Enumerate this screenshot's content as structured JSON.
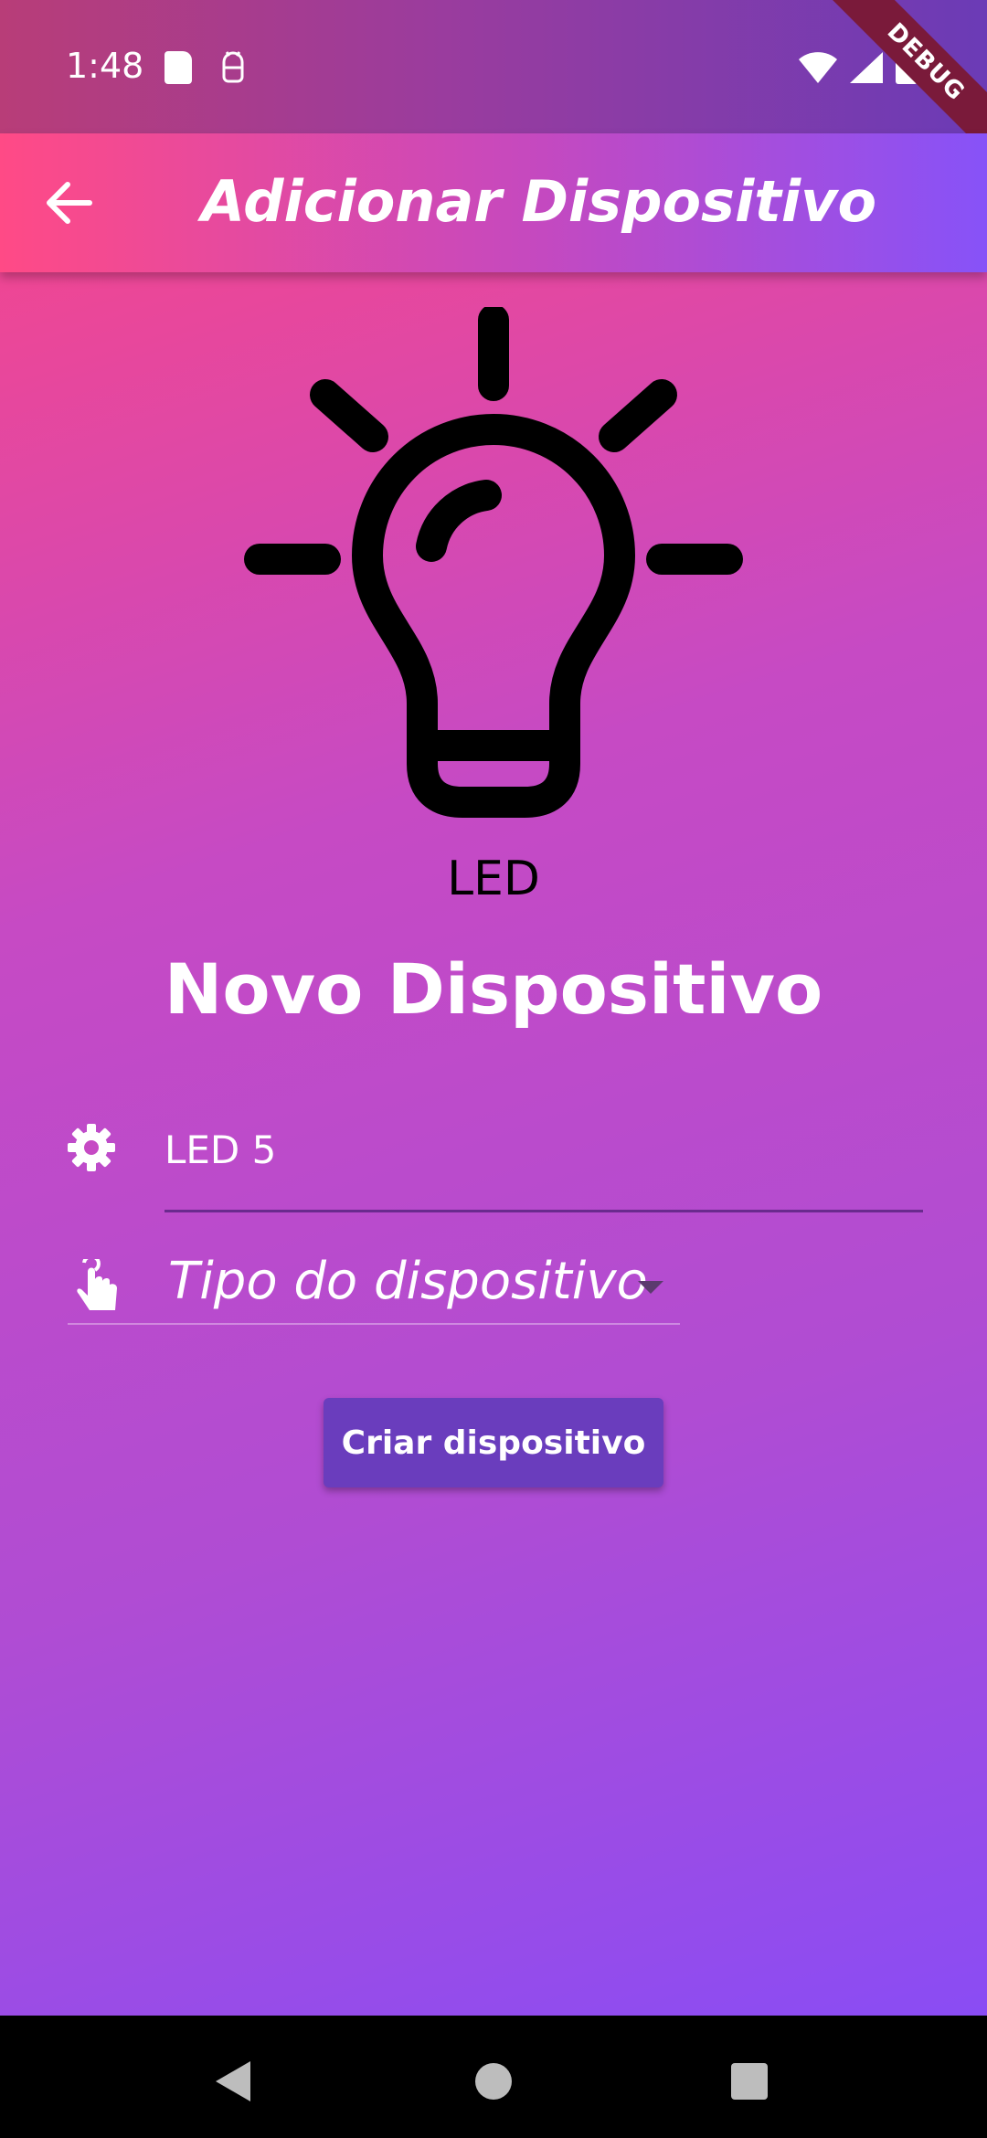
{
  "status_bar": {
    "time": "1:48",
    "debug_label": "DEBUG"
  },
  "app_bar": {
    "title": "Adicionar Dispositivo"
  },
  "device": {
    "type_label": "LED"
  },
  "page": {
    "title": "Novo Dispositivo"
  },
  "form": {
    "name_value": "LED 5",
    "type_placeholder": "Tipo do dispositivo",
    "submit_label": "Criar dispositivo"
  },
  "colors": {
    "button": "#6a3dbd",
    "gradient_top": "#ff4580",
    "gradient_bottom": "#8a4cf4"
  },
  "icons": {
    "back": "arrow-back-icon",
    "device": "lightbulb-icon",
    "name": "gear-icon",
    "type": "touch-hand-icon",
    "dropdown": "dropdown-arrow-icon"
  }
}
